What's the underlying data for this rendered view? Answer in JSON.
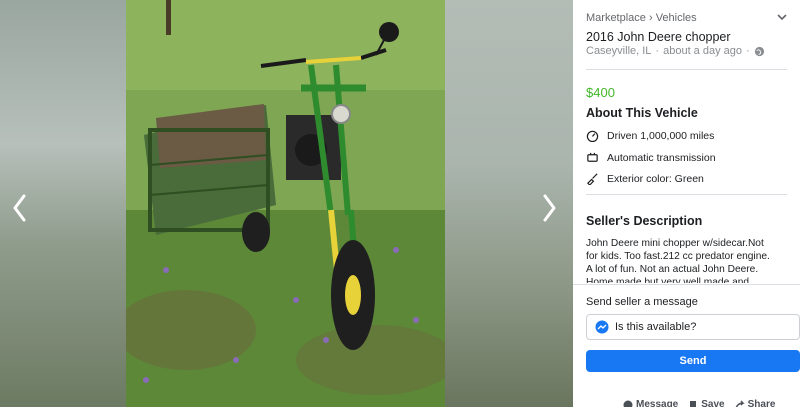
{
  "viewer": {
    "prev_icon": "chevron-left-icon",
    "next_icon": "chevron-right-icon"
  },
  "listing": {
    "breadcrumb": "Marketplace › Vehicles",
    "title": "2016 John Deere chopper",
    "location": "Caseyville, IL",
    "time": "about a day ago",
    "price": "$400",
    "about_heading": "About This Vehicle",
    "attributes": [
      {
        "icon": "speedometer-icon",
        "label": "Driven 1,000,000 miles"
      },
      {
        "icon": "transmission-icon",
        "label": "Automatic transmission"
      },
      {
        "icon": "paint-brush-icon",
        "label": "Exterior color: Green"
      }
    ],
    "description_heading": "Seller's Description",
    "description": "John Deere mini chopper w/sidecar.Not for kids.  Too fast.212 cc predator engine. A lot of fun.  Not an actual John Deere.  Home made but very well made and detailed.  The"
  },
  "message": {
    "label": "Send seller a message",
    "value": "Is this available?",
    "send": "Send"
  },
  "actions": {
    "message": "Message",
    "save": "Save",
    "share": "Share"
  },
  "colors": {
    "price": "#42b72a",
    "send_button": "#1877f2",
    "tractor_green": "#2e8b2e",
    "tractor_yellow": "#e8d23a"
  }
}
